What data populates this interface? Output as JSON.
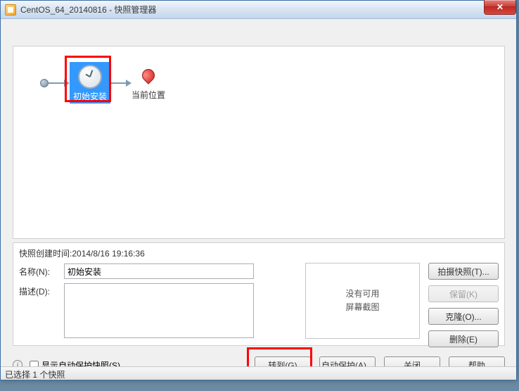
{
  "window": {
    "title": "CentOS_64_20140816 - 快照管理器",
    "close_glyph": "✕"
  },
  "timeline": {
    "snapshot": {
      "label": "初始安装"
    },
    "current": {
      "label": "当前位置"
    }
  },
  "details": {
    "created_label": "快照创建时间:",
    "created_value": "2014/8/16 19:16:36",
    "name_label": "名称(N):",
    "name_value": "初始安装",
    "desc_label": "描述(D):",
    "desc_value": "",
    "thumb_line1": "没有可用",
    "thumb_line2": "屏幕截图"
  },
  "buttons": {
    "take": "拍摄快照(T)...",
    "keep": "保留(K)",
    "clone": "克隆(O)...",
    "delete": "删除(E)",
    "goto": "转到(G)",
    "autoprotect": "自动保护(A)...",
    "close": "关闭",
    "help": "帮助"
  },
  "bottom": {
    "show_autoprotect": "显示自动保护快照(S)"
  },
  "status": {
    "text": "已选择 1 个快照"
  }
}
